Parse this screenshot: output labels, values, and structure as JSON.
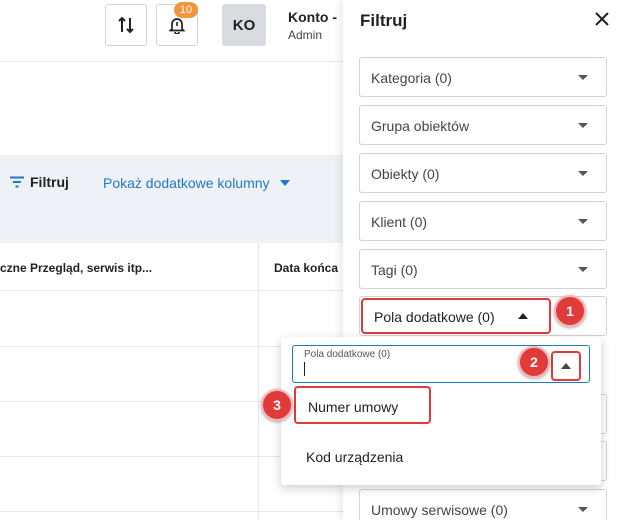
{
  "header": {
    "notifications_count": "10",
    "avatar_initials": "KO",
    "account_name": "Konto -",
    "account_role": "Admin"
  },
  "toolbar": {
    "filter_label": "Filtruj",
    "more_columns_label": "Pokaż dodatkowe kolumny"
  },
  "table": {
    "columns": [
      "czne Przegląd, serwis itp...",
      "Data końca"
    ]
  },
  "filter_panel": {
    "title": "Filtruj",
    "filters": [
      "Kategoria (0)",
      "Grupa obiektów",
      "Obiekty (0)",
      "Klient (0)",
      "Tagi (0)",
      "Pola dodatkowe (0)",
      "Umowy serwisowe (0)"
    ],
    "dropdown": {
      "search_label": "Pola dodatkowe (0)",
      "search_value": "",
      "options": [
        "Numer umowy",
        "Kod urządzenia"
      ]
    }
  },
  "annotations": [
    "1",
    "2",
    "3"
  ],
  "colors": {
    "accent_blue": "#1f7ac9",
    "highlight_red": "#e03a3a",
    "badge_orange": "#f0963d"
  }
}
